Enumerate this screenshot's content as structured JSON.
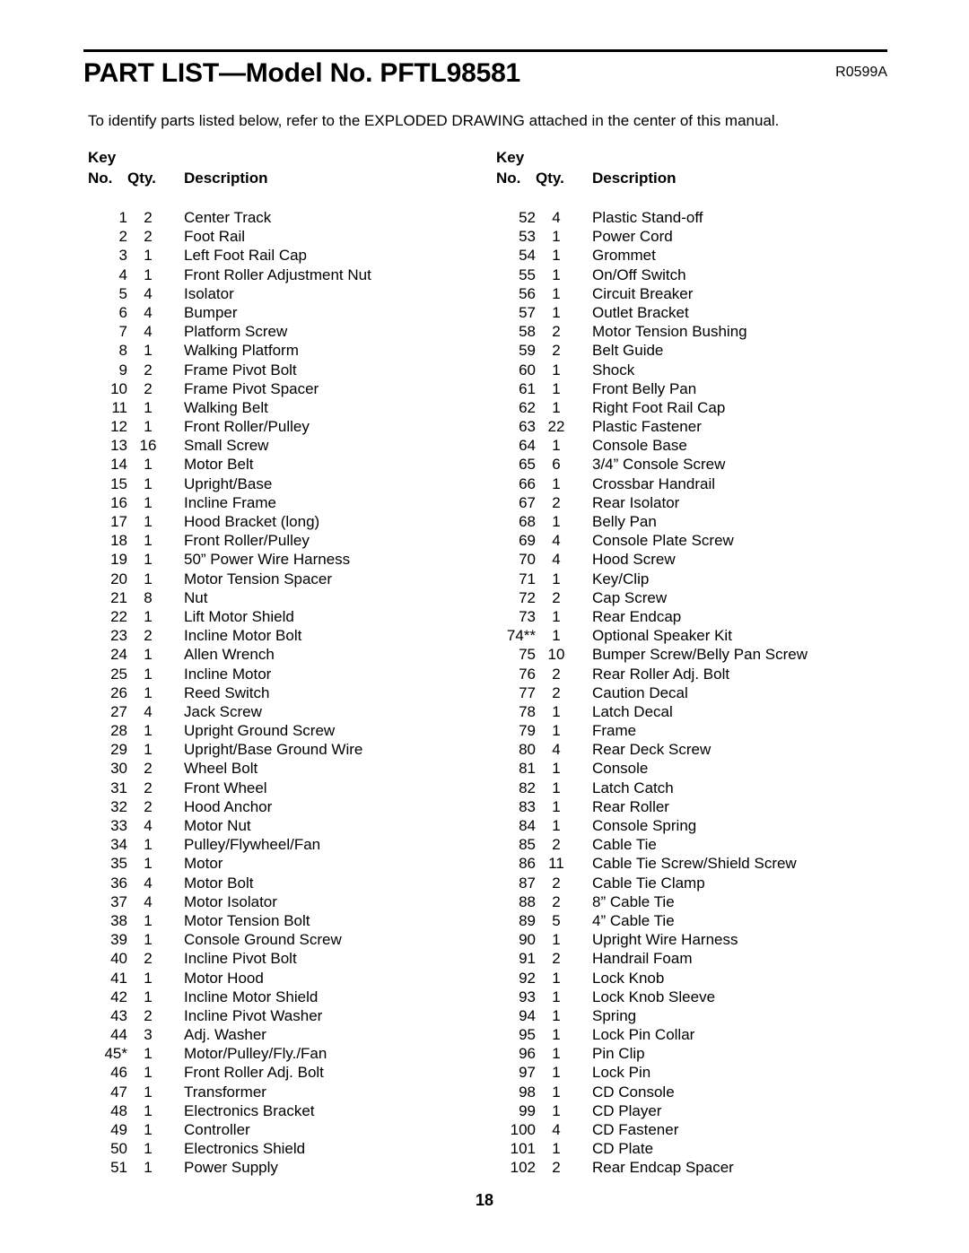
{
  "header": {
    "title": "PART LIST—Model No. PFTL98581",
    "revision_code": "R0599A"
  },
  "intro": "To identify parts listed below, refer to the EXPLODED DRAWING attached in the center of this manual.",
  "column_headers": {
    "key": "Key",
    "no": "No.",
    "qty": "Qty.",
    "description": "Description"
  },
  "footer": {
    "page_number": "18"
  },
  "parts": {
    "left": [
      {
        "key": "1",
        "qty": "2",
        "desc": "Center Track"
      },
      {
        "key": "2",
        "qty": "2",
        "desc": "Foot Rail"
      },
      {
        "key": "3",
        "qty": "1",
        "desc": "Left Foot Rail Cap"
      },
      {
        "key": "4",
        "qty": "1",
        "desc": "Front Roller Adjustment Nut"
      },
      {
        "key": "5",
        "qty": "4",
        "desc": "Isolator"
      },
      {
        "key": "6",
        "qty": "4",
        "desc": "Bumper"
      },
      {
        "key": "7",
        "qty": "4",
        "desc": "Platform Screw"
      },
      {
        "key": "8",
        "qty": "1",
        "desc": "Walking Platform"
      },
      {
        "key": "9",
        "qty": "2",
        "desc": "Frame Pivot Bolt"
      },
      {
        "key": "10",
        "qty": "2",
        "desc": "Frame Pivot Spacer"
      },
      {
        "key": "11",
        "qty": "1",
        "desc": "Walking Belt"
      },
      {
        "key": "12",
        "qty": "1",
        "desc": "Front Roller/Pulley"
      },
      {
        "key": "13",
        "qty": "16",
        "desc": "Small Screw"
      },
      {
        "key": "14",
        "qty": "1",
        "desc": "Motor Belt"
      },
      {
        "key": "15",
        "qty": "1",
        "desc": "Upright/Base"
      },
      {
        "key": "16",
        "qty": "1",
        "desc": "Incline Frame"
      },
      {
        "key": "17",
        "qty": "1",
        "desc": "Hood Bracket (long)"
      },
      {
        "key": "18",
        "qty": "1",
        "desc": "Front Roller/Pulley"
      },
      {
        "key": "19",
        "qty": "1",
        "desc": "50” Power Wire Harness"
      },
      {
        "key": "20",
        "qty": "1",
        "desc": "Motor Tension Spacer"
      },
      {
        "key": "21",
        "qty": "8",
        "desc": "Nut"
      },
      {
        "key": "22",
        "qty": "1",
        "desc": "Lift Motor Shield"
      },
      {
        "key": "23",
        "qty": "2",
        "desc": "Incline Motor Bolt"
      },
      {
        "key": "24",
        "qty": "1",
        "desc": "Allen Wrench"
      },
      {
        "key": "25",
        "qty": "1",
        "desc": "Incline Motor"
      },
      {
        "key": "26",
        "qty": "1",
        "desc": "Reed Switch"
      },
      {
        "key": "27",
        "qty": "4",
        "desc": "Jack Screw"
      },
      {
        "key": "28",
        "qty": "1",
        "desc": "Upright Ground Screw"
      },
      {
        "key": "29",
        "qty": "1",
        "desc": "Upright/Base Ground Wire"
      },
      {
        "key": "30",
        "qty": "2",
        "desc": "Wheel Bolt"
      },
      {
        "key": "31",
        "qty": "2",
        "desc": "Front Wheel"
      },
      {
        "key": "32",
        "qty": "2",
        "desc": "Hood Anchor"
      },
      {
        "key": "33",
        "qty": "4",
        "desc": "Motor Nut"
      },
      {
        "key": "34",
        "qty": "1",
        "desc": "Pulley/Flywheel/Fan"
      },
      {
        "key": "35",
        "qty": "1",
        "desc": "Motor"
      },
      {
        "key": "36",
        "qty": "4",
        "desc": "Motor Bolt"
      },
      {
        "key": "37",
        "qty": "4",
        "desc": "Motor Isolator"
      },
      {
        "key": "38",
        "qty": "1",
        "desc": "Motor Tension Bolt"
      },
      {
        "key": "39",
        "qty": "1",
        "desc": "Console Ground Screw"
      },
      {
        "key": "40",
        "qty": "2",
        "desc": "Incline Pivot Bolt"
      },
      {
        "key": "41",
        "qty": "1",
        "desc": "Motor Hood"
      },
      {
        "key": "42",
        "qty": "1",
        "desc": "Incline Motor Shield"
      },
      {
        "key": "43",
        "qty": "2",
        "desc": "Incline Pivot Washer"
      },
      {
        "key": "44",
        "qty": "3",
        "desc": "Adj. Washer"
      },
      {
        "key": "45*",
        "qty": "1",
        "desc": "Motor/Pulley/Fly./Fan"
      },
      {
        "key": "46",
        "qty": "1",
        "desc": "Front Roller Adj. Bolt"
      },
      {
        "key": "47",
        "qty": "1",
        "desc": "Transformer"
      },
      {
        "key": "48",
        "qty": "1",
        "desc": "Electronics Bracket"
      },
      {
        "key": "49",
        "qty": "1",
        "desc": "Controller"
      },
      {
        "key": "50",
        "qty": "1",
        "desc": "Electronics Shield"
      },
      {
        "key": "51",
        "qty": "1",
        "desc": "Power Supply"
      }
    ],
    "right": [
      {
        "key": "52",
        "qty": "4",
        "desc": "Plastic Stand-off"
      },
      {
        "key": "53",
        "qty": "1",
        "desc": "Power Cord"
      },
      {
        "key": "54",
        "qty": "1",
        "desc": "Grommet"
      },
      {
        "key": "55",
        "qty": "1",
        "desc": "On/Off Switch"
      },
      {
        "key": "56",
        "qty": "1",
        "desc": "Circuit Breaker"
      },
      {
        "key": "57",
        "qty": "1",
        "desc": "Outlet Bracket"
      },
      {
        "key": "58",
        "qty": "2",
        "desc": "Motor Tension Bushing"
      },
      {
        "key": "59",
        "qty": "2",
        "desc": "Belt Guide"
      },
      {
        "key": "60",
        "qty": "1",
        "desc": "Shock"
      },
      {
        "key": "61",
        "qty": "1",
        "desc": "Front Belly Pan"
      },
      {
        "key": "62",
        "qty": "1",
        "desc": "Right Foot Rail Cap"
      },
      {
        "key": "63",
        "qty": "22",
        "desc": "Plastic Fastener"
      },
      {
        "key": "64",
        "qty": "1",
        "desc": "Console Base"
      },
      {
        "key": "65",
        "qty": "6",
        "desc": "3/4” Console Screw"
      },
      {
        "key": "66",
        "qty": "1",
        "desc": "Crossbar Handrail"
      },
      {
        "key": "67",
        "qty": "2",
        "desc": "Rear Isolator"
      },
      {
        "key": "68",
        "qty": "1",
        "desc": "Belly Pan"
      },
      {
        "key": "69",
        "qty": "4",
        "desc": "Console Plate Screw"
      },
      {
        "key": "70",
        "qty": "4",
        "desc": "Hood Screw"
      },
      {
        "key": "71",
        "qty": "1",
        "desc": "Key/Clip"
      },
      {
        "key": "72",
        "qty": "2",
        "desc": "Cap Screw"
      },
      {
        "key": "73",
        "qty": "1",
        "desc": "Rear Endcap"
      },
      {
        "key": "74**",
        "qty": "1",
        "desc": "Optional Speaker Kit"
      },
      {
        "key": "75",
        "qty": "10",
        "desc": "Bumper Screw/Belly Pan Screw"
      },
      {
        "key": "76",
        "qty": "2",
        "desc": "Rear Roller Adj. Bolt"
      },
      {
        "key": "77",
        "qty": "2",
        "desc": "Caution Decal"
      },
      {
        "key": "78",
        "qty": "1",
        "desc": "Latch Decal"
      },
      {
        "key": "79",
        "qty": "1",
        "desc": "Frame"
      },
      {
        "key": "80",
        "qty": "4",
        "desc": "Rear Deck Screw"
      },
      {
        "key": "81",
        "qty": "1",
        "desc": "Console"
      },
      {
        "key": "82",
        "qty": "1",
        "desc": "Latch Catch"
      },
      {
        "key": "83",
        "qty": "1",
        "desc": "Rear Roller"
      },
      {
        "key": "84",
        "qty": "1",
        "desc": "Console Spring"
      },
      {
        "key": "85",
        "qty": "2",
        "desc": "Cable Tie"
      },
      {
        "key": "86",
        "qty": "11",
        "desc": "Cable Tie Screw/Shield Screw"
      },
      {
        "key": "87",
        "qty": "2",
        "desc": "Cable Tie Clamp"
      },
      {
        "key": "88",
        "qty": "2",
        "desc": "8” Cable Tie"
      },
      {
        "key": "89",
        "qty": "5",
        "desc": "4” Cable Tie"
      },
      {
        "key": "90",
        "qty": "1",
        "desc": "Upright Wire Harness"
      },
      {
        "key": "91",
        "qty": "2",
        "desc": "Handrail Foam"
      },
      {
        "key": "92",
        "qty": "1",
        "desc": "Lock Knob"
      },
      {
        "key": "93",
        "qty": "1",
        "desc": "Lock Knob Sleeve"
      },
      {
        "key": "94",
        "qty": "1",
        "desc": "Spring"
      },
      {
        "key": "95",
        "qty": "1",
        "desc": "Lock Pin Collar"
      },
      {
        "key": "96",
        "qty": "1",
        "desc": "Pin Clip"
      },
      {
        "key": "97",
        "qty": "1",
        "desc": "Lock Pin"
      },
      {
        "key": "98",
        "qty": "1",
        "desc": "CD Console"
      },
      {
        "key": "99",
        "qty": "1",
        "desc": "CD Player"
      },
      {
        "key": "100",
        "qty": "4",
        "desc": "CD Fastener"
      },
      {
        "key": "101",
        "qty": "1",
        "desc": "CD Plate"
      },
      {
        "key": "102",
        "qty": "2",
        "desc": "Rear Endcap Spacer"
      }
    ]
  }
}
